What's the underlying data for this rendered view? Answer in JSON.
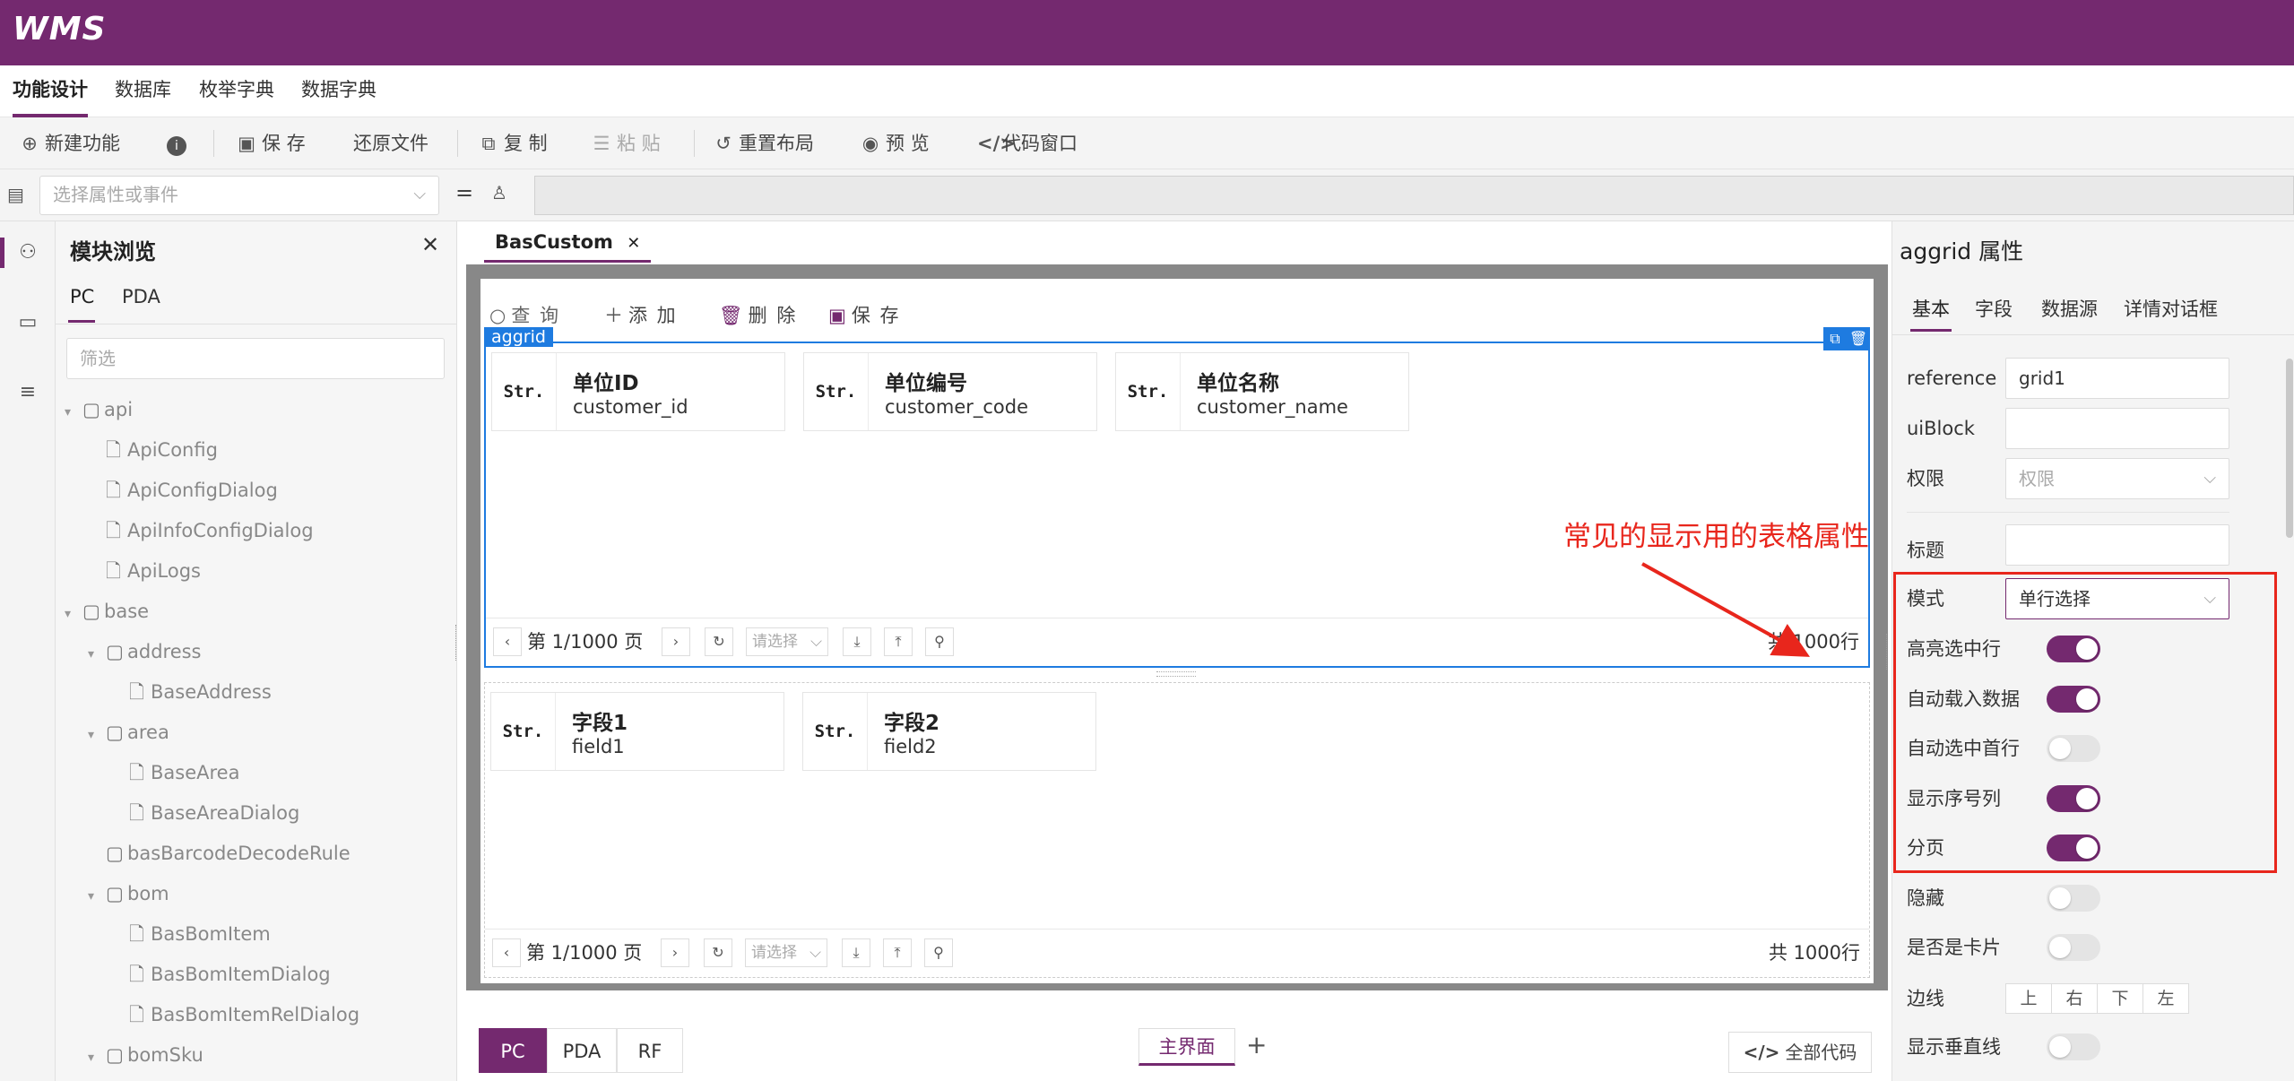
{
  "app": {
    "logo": "WMS"
  },
  "menu": [
    "功能设计",
    "数据库",
    "枚举字典",
    "数据字典"
  ],
  "toolbar": {
    "new": "新建功能",
    "save": "保 存",
    "restore": "还原文件",
    "copy": "复 制",
    "paste": "粘 贴",
    "reset_layout": "重置布局",
    "preview": "预 览",
    "code_window": "代码窗口"
  },
  "expr": {
    "placeholder": "选择属性或事件",
    "equals": "="
  },
  "module_panel": {
    "title": "模块浏览",
    "tabs": [
      "PC",
      "PDA"
    ],
    "filter_placeholder": "筛选",
    "tree": [
      {
        "label": "api",
        "type": "folder",
        "open": true
      },
      {
        "label": "ApiConfig",
        "type": "file"
      },
      {
        "label": "ApiConfigDialog",
        "type": "file"
      },
      {
        "label": "ApiInfoConfigDialog",
        "type": "file"
      },
      {
        "label": "ApiLogs",
        "type": "file"
      },
      {
        "label": "base",
        "type": "folder",
        "open": true
      },
      {
        "label": "address",
        "type": "folder",
        "open": true
      },
      {
        "label": "BaseAddress",
        "type": "file"
      },
      {
        "label": "area",
        "type": "folder",
        "open": true
      },
      {
        "label": "BaseArea",
        "type": "file"
      },
      {
        "label": "BaseAreaDialog",
        "type": "file"
      },
      {
        "label": "basBarcodeDecodeRule",
        "type": "folder",
        "open": false
      },
      {
        "label": "bom",
        "type": "folder",
        "open": true
      },
      {
        "label": "BasBomItem",
        "type": "file"
      },
      {
        "label": "BasBomItemDialog",
        "type": "file"
      },
      {
        "label": "BasBomItemRelDialog",
        "type": "file"
      },
      {
        "label": "bomSku",
        "type": "folder",
        "open": true
      }
    ]
  },
  "doc_tab": {
    "label": "BasCustom",
    "close": "✕"
  },
  "grid_toolbar": {
    "query": "查 询",
    "add": "添 加",
    "delete": "删 除",
    "save": "保 存"
  },
  "grid1": {
    "label": "aggrid",
    "columns": [
      {
        "type": "Str.",
        "title": "单位ID",
        "field": "customer_id"
      },
      {
        "type": "Str.",
        "title": "单位编号",
        "field": "customer_code"
      },
      {
        "type": "Str.",
        "title": "单位名称",
        "field": "customer_name"
      }
    ],
    "pager": {
      "page": "第 1/1000 页",
      "select_placeholder": "请选择",
      "total": "共 1000行"
    }
  },
  "grid2": {
    "columns": [
      {
        "type": "Str.",
        "title": "字段1",
        "field": "field1"
      },
      {
        "type": "Str.",
        "title": "字段2",
        "field": "field2"
      }
    ],
    "pager": {
      "page": "第 1/1000 页",
      "select_placeholder": "请选择",
      "total": "共 1000行"
    }
  },
  "annotation": "常见的显示用的表格属性",
  "device_tabs": [
    "PC",
    "PDA",
    "RF"
  ],
  "view_tab": "主界面",
  "add_view": "+",
  "all_code": "全部代码",
  "props": {
    "title": "aggrid 属性",
    "tabs": [
      "基本",
      "字段",
      "数据源",
      "详情对话框"
    ],
    "reference_label": "reference",
    "reference_value": "grid1",
    "uiblock_label": "uiBlock",
    "permission_label": "权限",
    "permission_placeholder": "权限",
    "title_label": "标题",
    "mode_label": "模式",
    "mode_value": "单行选择",
    "toggles": [
      {
        "label": "高亮选中行",
        "on": true
      },
      {
        "label": "自动载入数据",
        "on": true
      },
      {
        "label": "自动选中首行",
        "on": false
      },
      {
        "label": "显示序号列",
        "on": true
      },
      {
        "label": "分页",
        "on": true
      },
      {
        "label": "隐藏",
        "on": false
      },
      {
        "label": "是否是卡片",
        "on": false
      }
    ],
    "border_label": "边线",
    "border_options": [
      "上",
      "右",
      "下",
      "左"
    ],
    "vline_label": "显示垂直线",
    "vline_on": false
  },
  "colors": {
    "brand": "#74296f",
    "selection": "#1e7be0",
    "annotation": "#e8261c"
  }
}
